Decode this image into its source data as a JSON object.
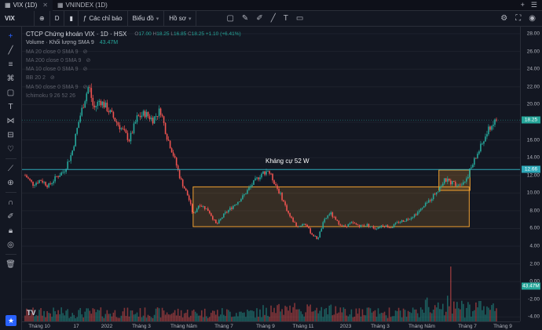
{
  "tabs": [
    {
      "label": "VIX (1D)",
      "active": true
    },
    {
      "label": "VNINDEX (1D)",
      "active": false
    }
  ],
  "toolbar": {
    "symbol": "VIX",
    "interval": "D",
    "indicators_label": "Các chỉ báo",
    "chart_type_label": "Biểu đồ",
    "profile_label": "Hồ sơ"
  },
  "legend": {
    "title": "CTCP Chứng khoán VIX · 1D · HSX",
    "ohlc": {
      "o_label": "O",
      "o": "17.00",
      "h_label": "H",
      "h": "18.25",
      "l_label": "L",
      "l": "16.85",
      "c_label": "C",
      "c": "18.25",
      "chg": "+1.10 (+6.41%)"
    },
    "volume_label": "Volume · Khối lượng SMA 9",
    "volume_value": "43.47M",
    "indicators": [
      "MA 20 close 0 SMA 9",
      "MA 200 close 0 SMA 9",
      "MA 10 close 0 SMA 9",
      "BB 20 2",
      "MA 50 close 0 SMA 9",
      "Ichimoku 9 26 52 26"
    ]
  },
  "annotation": "Kháng cự 52 W",
  "price_axis": {
    "ticks": [
      "28.00",
      "26.00",
      "24.00",
      "22.00",
      "20.00",
      "18.00",
      "16.00",
      "14.00",
      "12.00",
      "10.00",
      "8.00",
      "6.00",
      "4.00",
      "2.00",
      "0.00",
      "-2.00",
      "-4.00"
    ],
    "last_price": "18.25",
    "resistance": "12.66",
    "volume_tag": "43.47M",
    "last_color": "#26a69a",
    "resistance_color": "#2fa8b8"
  },
  "time_axis": [
    "Tháng 10",
    "17",
    "2022",
    "Tháng 3",
    "Tháng Năm",
    "Tháng 7",
    "Tháng 9",
    "Tháng 11",
    "2023",
    "Tháng 3",
    "Tháng Năm",
    "Tháng 7",
    "Tháng 9"
  ],
  "chart_data": {
    "type": "candlestick",
    "ylim": [
      -4.5,
      28.8
    ],
    "resistance_level": 12.66,
    "last_price": 18.25,
    "boxes": [
      {
        "y_low": 6.2,
        "y_high": 10.7
      },
      {
        "y_low": 10.3,
        "y_high": 12.6
      }
    ],
    "close_trajectory": [
      [
        0,
        12.0
      ],
      [
        10,
        11.0
      ],
      [
        20,
        11.5
      ],
      [
        30,
        10.8
      ],
      [
        40,
        11.8
      ],
      [
        50,
        12.5
      ],
      [
        60,
        14.5
      ],
      [
        70,
        18.5
      ],
      [
        78,
        21.0
      ],
      [
        82,
        22.2
      ],
      [
        88,
        19.5
      ],
      [
        96,
        20.5
      ],
      [
        106,
        19.5
      ],
      [
        116,
        18.2
      ],
      [
        126,
        17.0
      ],
      [
        134,
        16.0
      ],
      [
        144,
        18.5
      ],
      [
        154,
        19.0
      ],
      [
        164,
        18.3
      ],
      [
        174,
        19.4
      ],
      [
        182,
        16.5
      ],
      [
        190,
        14.5
      ],
      [
        200,
        11.5
      ],
      [
        210,
        9.5
      ],
      [
        216,
        7.5
      ],
      [
        224,
        8.8
      ],
      [
        236,
        8.0
      ],
      [
        246,
        6.4
      ],
      [
        256,
        7.6
      ],
      [
        268,
        8.6
      ],
      [
        280,
        9.6
      ],
      [
        292,
        11.0
      ],
      [
        304,
        12.2
      ],
      [
        312,
        12.6
      ],
      [
        320,
        11.3
      ],
      [
        330,
        9.5
      ],
      [
        340,
        7.4
      ],
      [
        350,
        6.2
      ],
      [
        360,
        6.6
      ],
      [
        368,
        5.4
      ],
      [
        376,
        4.8
      ],
      [
        384,
        6.8
      ],
      [
        392,
        7.8
      ],
      [
        400,
        6.8
      ],
      [
        410,
        6.2
      ],
      [
        420,
        6.6
      ],
      [
        430,
        6.3
      ],
      [
        440,
        6.4
      ],
      [
        450,
        6.0
      ],
      [
        460,
        6.4
      ],
      [
        470,
        6.1
      ],
      [
        480,
        6.7
      ],
      [
        490,
        7.0
      ],
      [
        500,
        7.5
      ],
      [
        510,
        8.2
      ],
      [
        520,
        9.2
      ],
      [
        530,
        10.3
      ],
      [
        540,
        11.5
      ],
      [
        548,
        11.2
      ],
      [
        556,
        11.0
      ],
      [
        566,
        11.4
      ],
      [
        572,
        12.6
      ],
      [
        582,
        14.5
      ],
      [
        590,
        16.0
      ],
      [
        598,
        17.5
      ],
      [
        606,
        18.25
      ]
    ]
  },
  "colors": {
    "up": "#26a69a",
    "down": "#ef5350",
    "box": "#f0a030",
    "bg": "#131722"
  }
}
